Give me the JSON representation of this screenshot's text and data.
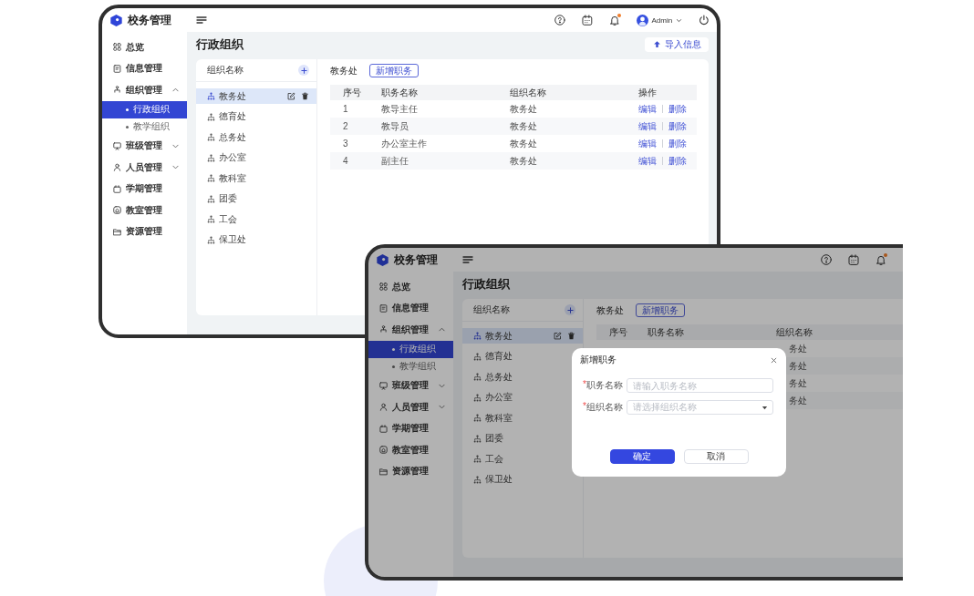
{
  "screens": [
    {
      "logo": {
        "text": "校务管理"
      },
      "header": {
        "actions": [
          {
            "kind": "help"
          },
          {
            "kind": "calendar"
          },
          {
            "kind": "bell",
            "unread": true
          },
          {
            "kind": "user",
            "label": "Admin"
          },
          {
            "kind": "power"
          }
        ]
      },
      "nav": [
        {
          "kind": "link",
          "label": "总览",
          "selected": false
        },
        {
          "kind": "link",
          "label": "信息管理",
          "selected": false
        },
        {
          "kind": "group",
          "label": "组织管理",
          "selected": false,
          "expanded": true,
          "children": [
            {
              "label": "行政组织",
              "selected": true
            },
            {
              "label": "教学组织",
              "selected": false
            }
          ]
        },
        {
          "kind": "group",
          "label": "班级管理",
          "selected": false,
          "expanded": false
        },
        {
          "kind": "group",
          "label": "人员管理",
          "selected": false,
          "expanded": false
        },
        {
          "kind": "link",
          "label": "学期管理",
          "selected": false
        },
        {
          "kind": "link",
          "label": "教室管理",
          "selected": false
        },
        {
          "kind": "link",
          "label": "资源管理",
          "selected": false
        }
      ],
      "page_title": "行政组织",
      "import_button": {
        "label": "导入信息"
      },
      "org_tree": {
        "title": "组织名称",
        "items": [
          {
            "label": "教务处",
            "selected": true
          },
          {
            "label": "德育处",
            "selected": false
          },
          {
            "label": "总务处",
            "selected": false
          },
          {
            "label": "办公室",
            "selected": false
          },
          {
            "label": "教科室",
            "selected": false
          },
          {
            "label": "团委",
            "selected": false
          },
          {
            "label": "工会",
            "selected": false
          },
          {
            "label": "保卫处",
            "selected": false
          }
        ]
      },
      "positions": {
        "org_label": "教务处",
        "add_button": {
          "label": "新增职务"
        },
        "table": {
          "columns": [
            "序号",
            "职务名称",
            "组织名称",
            "操作"
          ],
          "rows": [
            {
              "no": "1",
              "title": "教导主任",
              "org": "教务处",
              "actions": [
                "编辑",
                "删除"
              ]
            },
            {
              "no": "2",
              "title": "教导员",
              "org": "教务处",
              "actions": [
                "编辑",
                "删除"
              ]
            },
            {
              "no": "3",
              "title": "办公室主作",
              "org": "教务处",
              "actions": [
                "编辑",
                "删除"
              ]
            },
            {
              "no": "4",
              "title": "副主任",
              "org": "教务处",
              "actions": [
                "编辑",
                "删除"
              ]
            }
          ]
        }
      }
    },
    {
      "logo": {
        "text": "校务管理"
      },
      "header": {
        "actions": [
          {
            "kind": "help"
          },
          {
            "kind": "calendar"
          },
          {
            "kind": "bell",
            "unread": true
          }
        ]
      },
      "nav": [
        {
          "kind": "link",
          "label": "总览",
          "selected": false
        },
        {
          "kind": "link",
          "label": "信息管理",
          "selected": false
        },
        {
          "kind": "group",
          "label": "组织管理",
          "selected": false,
          "expanded": true,
          "children": [
            {
              "label": "行政组织",
              "selected": true
            },
            {
              "label": "教学组织",
              "selected": false
            }
          ]
        },
        {
          "kind": "group",
          "label": "班级管理",
          "selected": false,
          "expanded": false
        },
        {
          "kind": "group",
          "label": "人员管理",
          "selected": false,
          "expanded": false
        },
        {
          "kind": "link",
          "label": "学期管理",
          "selected": false
        },
        {
          "kind": "link",
          "label": "教室管理",
          "selected": false
        },
        {
          "kind": "link",
          "label": "资源管理",
          "selected": false
        }
      ],
      "page_title": "行政组织",
      "org_tree": {
        "title": "组织名称",
        "items": [
          {
            "label": "教务处",
            "selected": true
          },
          {
            "label": "德育处",
            "selected": false
          },
          {
            "label": "总务处",
            "selected": false
          },
          {
            "label": "办公室",
            "selected": false
          },
          {
            "label": "教科室",
            "selected": false
          },
          {
            "label": "团委",
            "selected": false
          },
          {
            "label": "工会",
            "selected": false
          },
          {
            "label": "保卫处",
            "selected": false
          }
        ]
      },
      "positions": {
        "org_label": "教务处",
        "add_button": {
          "label": "新增职务"
        },
        "table": {
          "columns": [
            "序号",
            "职务名称",
            "组织名称"
          ],
          "rows": [
            {
              "org": "务处"
            },
            {
              "org": "务处"
            },
            {
              "org": "务处"
            },
            {
              "org": "务处"
            }
          ]
        }
      },
      "modal": {
        "title": "新增职务",
        "fields": [
          {
            "kind": "input",
            "required_mark": "*",
            "label": "职务名称",
            "placeholder": "请输入职务名称"
          },
          {
            "kind": "select",
            "required_mark": "*",
            "label": "组织名称",
            "placeholder": "请选择组织名称"
          }
        ],
        "buttons": [
          {
            "kind": "primary",
            "label": "确定"
          },
          {
            "kind": "default",
            "label": "取消"
          }
        ]
      }
    }
  ]
}
